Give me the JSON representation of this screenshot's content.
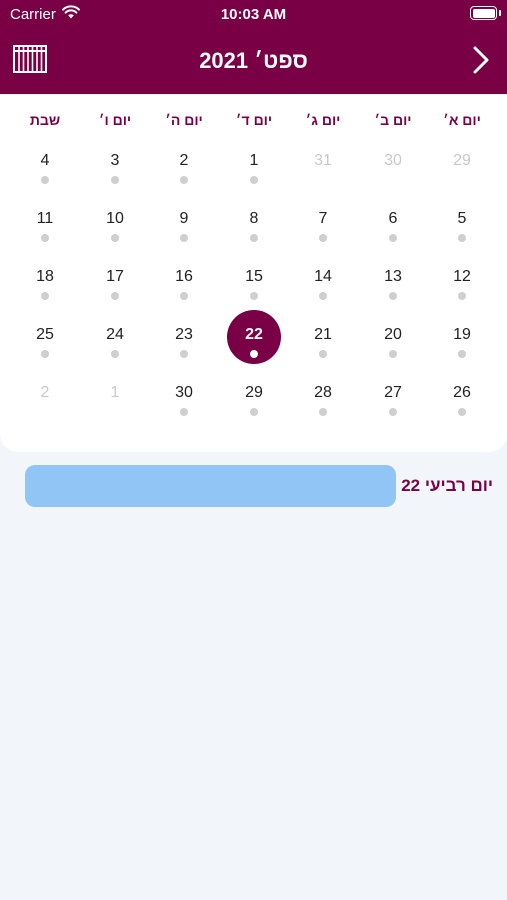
{
  "status": {
    "carrier": "Carrier",
    "time": "10:03 AM"
  },
  "header": {
    "title": "ספט׳ 2021",
    "calendar_icon": "calendar-grid-icon",
    "next_icon": "chevron-right-icon"
  },
  "colors": {
    "brand": "#7a0046",
    "event": "#91c5f6",
    "background": "#f2f6fa"
  },
  "weekdays": [
    "יום א׳",
    "יום ב׳",
    "יום ג׳",
    "יום ד׳",
    "יום ה׳",
    "יום ו׳",
    "שבת"
  ],
  "weeks": [
    [
      {
        "n": "29",
        "m": true
      },
      {
        "n": "30",
        "m": true
      },
      {
        "n": "31",
        "m": true
      },
      {
        "n": "1"
      },
      {
        "n": "2"
      },
      {
        "n": "3"
      },
      {
        "n": "4"
      }
    ],
    [
      {
        "n": "5"
      },
      {
        "n": "6"
      },
      {
        "n": "7"
      },
      {
        "n": "8"
      },
      {
        "n": "9"
      },
      {
        "n": "10"
      },
      {
        "n": "11"
      }
    ],
    [
      {
        "n": "12"
      },
      {
        "n": "13"
      },
      {
        "n": "14"
      },
      {
        "n": "15"
      },
      {
        "n": "16"
      },
      {
        "n": "17"
      },
      {
        "n": "18"
      }
    ],
    [
      {
        "n": "19"
      },
      {
        "n": "20"
      },
      {
        "n": "21"
      },
      {
        "n": "22",
        "s": true
      },
      {
        "n": "23"
      },
      {
        "n": "24"
      },
      {
        "n": "25"
      }
    ],
    [
      {
        "n": "26"
      },
      {
        "n": "27"
      },
      {
        "n": "28"
      },
      {
        "n": "29"
      },
      {
        "n": "30"
      },
      {
        "n": "1",
        "m": true
      },
      {
        "n": "2",
        "m": true
      }
    ]
  ],
  "selected_day": {
    "label": "יום רביעי 22"
  }
}
